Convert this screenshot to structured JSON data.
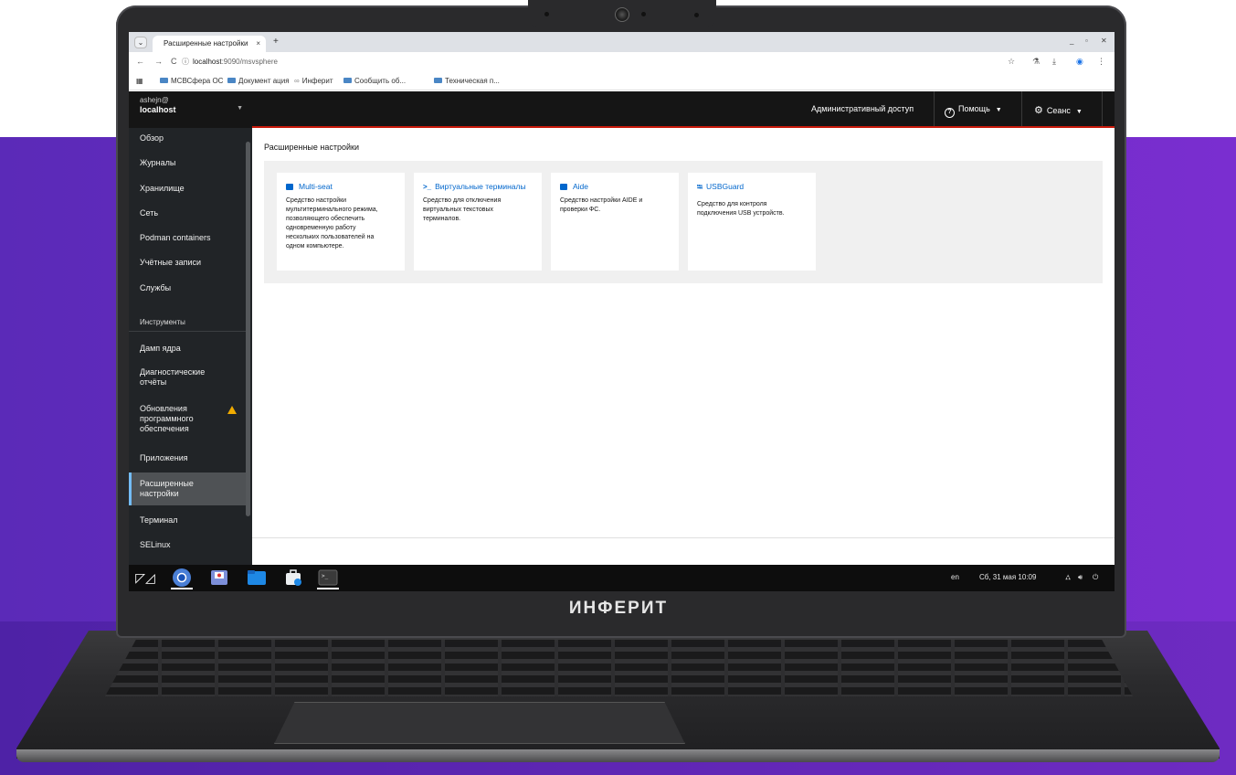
{
  "browser": {
    "tab_title": "Расширенные настройки",
    "tab_close": "×",
    "new_tab": "+",
    "url_host": "localhost",
    "url_rest": ":9090/msvsphere",
    "bookmarks": [
      "МСВСфера ОС",
      "Документ ация",
      "Инферит",
      "Сообщить об...",
      "Техническая п..."
    ]
  },
  "cockpit": {
    "user": "ashejn@",
    "host": "localhost",
    "topbar": {
      "admin_access": "Административный доступ",
      "help": "Помощь",
      "session": "Сеанс"
    },
    "nav": {
      "overview": "Обзор",
      "logs": "Журналы",
      "storage": "Хранилище",
      "network": "Сеть",
      "podman": "Podman containers",
      "accounts": "Учётные записи",
      "services": "Службы",
      "tools_section": "Инструменты",
      "kdump": "Дамп ядра",
      "diag1": "Диагностические",
      "diag2": "отчёты",
      "upd1": "Обновления",
      "upd2": "программного",
      "upd3": "обеспечения",
      "apps": "Приложения",
      "adv1": "Расширенные",
      "adv2": "настройки",
      "terminal": "Терминал",
      "selinux": "SELinux"
    },
    "page_title": "Расширенные настройки",
    "cards": [
      {
        "title": "Multi-seat",
        "desc": [
          "Средство настройки",
          "мультитерминального режима,",
          "позволяющего обеспечить",
          "одновременную работу",
          "нескольких пользователей на",
          "одном компьютере."
        ]
      },
      {
        "title": "Виртуальные терминалы",
        "desc": [
          "Средство для отключения",
          "виртуальных текстовых",
          "терминалов."
        ]
      },
      {
        "title": "Aide",
        "desc": [
          "Средство настройки AIDE и",
          "проверки ФС."
        ]
      },
      {
        "title": "USBGuard",
        "desc": [
          "Средство для контроля",
          "подключения USB устройств."
        ]
      }
    ]
  },
  "taskbar": {
    "lang": "en",
    "datetime": "Сб, 31 мая 10:09"
  },
  "laptop_brand": "ИНФЕРИТ"
}
